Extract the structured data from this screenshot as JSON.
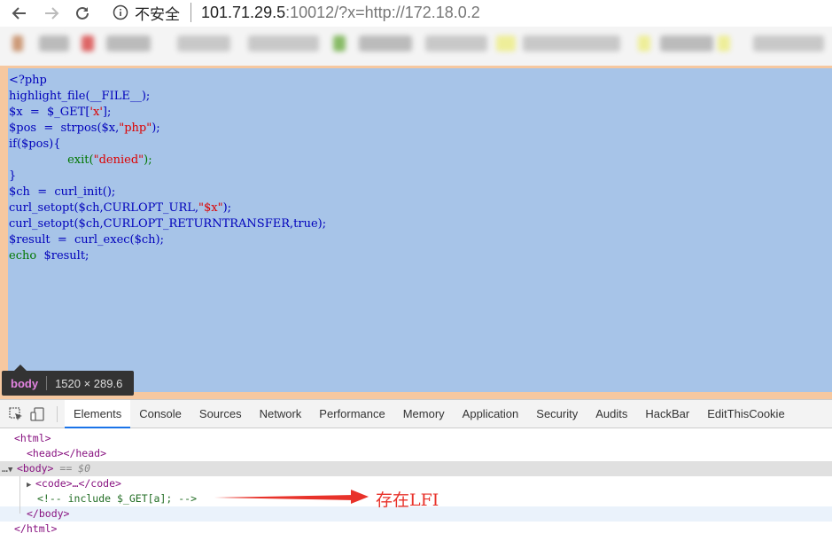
{
  "browser": {
    "insecure_label": "不安全",
    "url_host": "101.71.29.5",
    "url_rest": ":10012/?x=http://172.18.0.2"
  },
  "page": {
    "code_lines": {
      "l1": "<?php",
      "l2": "highlight_file(__FILE__);",
      "l3a": "$x  =  $_GET[",
      "l3b": "'x'",
      "l3c": "];",
      "l4a": "$pos  =  strpos($x,",
      "l4b": "\"php\"",
      "l4c": ");",
      "l5": "if($pos){",
      "l6a": "                exit(",
      "l6b": "\"denied\"",
      "l6c": ");",
      "l7": "}",
      "l8": "$ch  =  curl_init();",
      "l9a": "curl_setopt($ch,CURLOPT_URL,",
      "l9b": "\"$x\"",
      "l9c": ");",
      "l10": "curl_setopt($ch,CURLOPT_RETURNTRANSFER,true);",
      "l11": "$result  =  curl_exec($ch);",
      "l12a": "echo",
      "l12b": "  $result;"
    }
  },
  "tooltip": {
    "tag": "body",
    "dimensions": "1520 × 289.6"
  },
  "devtools": {
    "tabs": [
      "Elements",
      "Console",
      "Sources",
      "Network",
      "Performance",
      "Memory",
      "Application",
      "Security",
      "Audits",
      "HackBar",
      "EditThisCookie"
    ],
    "active_tab": "Elements",
    "tree": {
      "html_open": "<html>",
      "head": "<head></head>",
      "body_open": "<body>",
      "body_marker": " == $0",
      "code": "<code>…</code>",
      "comment": "<!-- include $_GET[a]; -->",
      "body_close": "</body>",
      "html_close": "</html>"
    }
  },
  "annotation": {
    "text": "存在LFI",
    "color": "#e8322a"
  }
}
